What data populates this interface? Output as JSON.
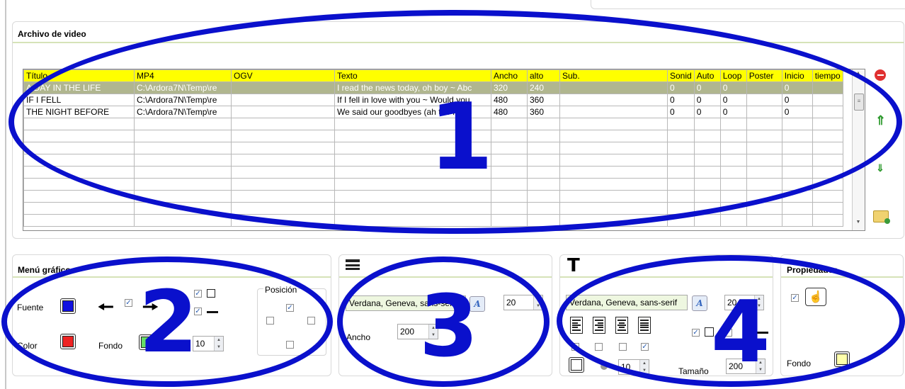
{
  "video_panel": {
    "title": "Archivo de video",
    "columns": [
      "Título",
      "MP4",
      "OGV",
      "Texto",
      "Ancho",
      "alto",
      "Sub.",
      "Sonid",
      "Auto",
      "Loop",
      "Poster",
      "Inicio",
      "tiempo"
    ],
    "rows": [
      [
        "A DAY IN THE LIFE",
        "C:\\Ardora7N\\Temp\\re",
        "",
        "I read the news today, oh boy ~ Abc",
        "320",
        "240",
        "",
        "0",
        "0",
        "0",
        "",
        "0",
        ""
      ],
      [
        "IF I FELL",
        "C:\\Ardora7N\\Temp\\re",
        "",
        "If I fell in love with you ~ Would you",
        "480",
        "360",
        "",
        "0",
        "0",
        "0",
        "",
        "0",
        ""
      ],
      [
        "THE NIGHT BEFORE",
        "C:\\Ardora7N\\Temp\\re",
        "",
        "We said our goodbyes (ah the night",
        "480",
        "360",
        "",
        "0",
        "0",
        "0",
        "",
        "0",
        ""
      ]
    ],
    "empty_rows": 9
  },
  "menu_panel": {
    "title": "Menú gráfico",
    "fuente_label": "Fuente",
    "color_label": "Color",
    "fondo_label": "Fondo",
    "posicion_label": "Posición",
    "number_value": "10",
    "fuente_color": "#1010e0",
    "color_color": "#ee2222",
    "fondo_color": "#66dd66"
  },
  "text_panel": {
    "font_value": "Verdana, Geneva, sans-serif",
    "size_value": "20",
    "ancho_label": "Ancho",
    "ancho_value": "200"
  },
  "title_panel": {
    "font_value": "Verdana, Geneva, sans-serif",
    "size_value": "20",
    "number_value": "10",
    "tamano_label": "Tamaño",
    "tamano_value": "200"
  },
  "props_panel": {
    "title": "Propiedades",
    "fondo_label": "Fondo",
    "fondo_color": "#ffffaa"
  },
  "annotations": [
    "1",
    "2",
    "3",
    "4"
  ],
  "colors": {
    "annotation": "#0a10cc",
    "header": "#ffff00",
    "selected_row": "#b0b68f",
    "underline": "#d6e3b8"
  }
}
